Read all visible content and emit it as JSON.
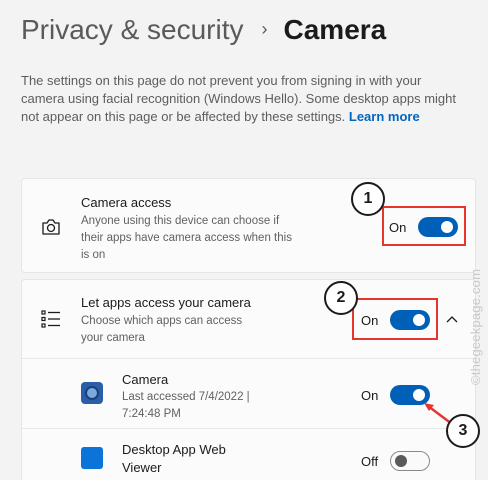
{
  "breadcrumb": {
    "parent": "Privacy & security",
    "separator": "›",
    "current": "Camera"
  },
  "description": {
    "text": "The settings on this page do not prevent you from signing in with your camera using facial recognition (Windows Hello). Some desktop apps might not appear on this page or be affected by these settings.",
    "link": "Learn more"
  },
  "camera_access": {
    "title": "Camera access",
    "subtitle": "Anyone using this device can choose if their apps have camera access when this is on",
    "state_label": "On",
    "state": true,
    "icon": "camera-icon"
  },
  "apps_access": {
    "title": "Let apps access your camera",
    "subtitle": "Choose which apps can access your camera",
    "state_label": "On",
    "state": true,
    "icon": "list-icon",
    "expanded": true
  },
  "apps": [
    {
      "name": "Camera",
      "detail": "Last accessed 7/4/2022  |  7:24:48 PM",
      "state_label": "On",
      "state": true,
      "icon": "camera-app-icon"
    },
    {
      "name": "Desktop App Web Viewer",
      "state_label": "Off",
      "state": false,
      "icon": "web-viewer-app-icon"
    }
  ],
  "annotations": [
    "1",
    "2",
    "3"
  ],
  "watermark": "©thegeekpage.com",
  "colors": {
    "accent": "#0060b8",
    "annotation": "#e5352f",
    "link": "#0067c0"
  }
}
